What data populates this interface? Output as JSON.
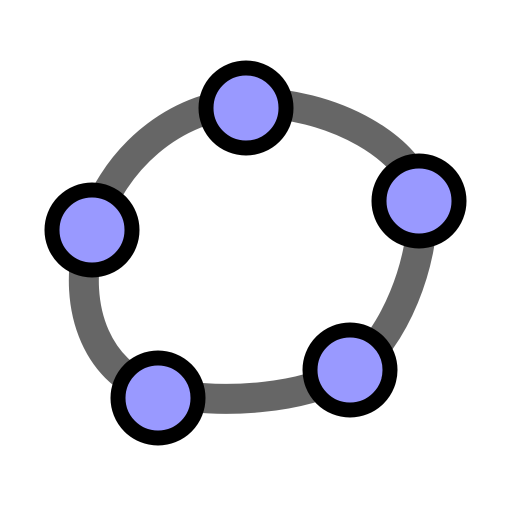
{
  "logo": {
    "icon": "geogebra-logo-icon",
    "colors": {
      "ellipse_stroke": "#666666",
      "point_fill": "#9999ff",
      "point_stroke": "#000000",
      "background": "#ffffff"
    },
    "point_count": 5
  }
}
